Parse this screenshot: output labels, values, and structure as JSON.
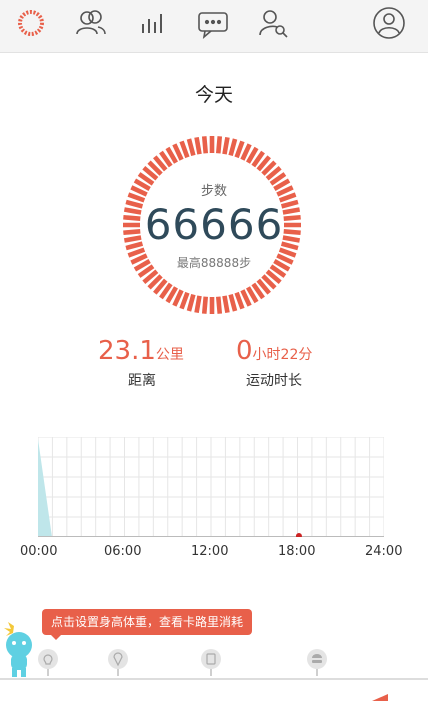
{
  "topbar": {
    "icons": [
      "ring-icon",
      "friends-icon",
      "bar-chart-icon",
      "message-icon",
      "find-friend-icon",
      "profile-icon"
    ],
    "accent": "#e8604a"
  },
  "main": {
    "date_label": "今天",
    "steps_label": "步数",
    "steps_value": "66666",
    "best_label": "最高88888步"
  },
  "stats": {
    "distance_value": "23.1",
    "distance_unit": "公里",
    "distance_label": "距离",
    "duration_hours_value": "0",
    "duration_hours_unit": "小时",
    "duration_minutes_value": "22",
    "duration_minutes_unit": "分",
    "duration_label": "运动时长"
  },
  "chart": {
    "x_labels": [
      "00:00",
      "06:00",
      "12:00",
      "18:00",
      "24:00"
    ],
    "grid_color": "#e6e6e6",
    "area_color": "#bfe6ea",
    "marker_color": "#cc2222"
  },
  "tip": {
    "text": "点击设置身高体重，查看卡路里消耗"
  },
  "food_icons": [
    "lightbulb-icon",
    "ice-cream-icon",
    "cup-icon",
    "burger-icon"
  ]
}
